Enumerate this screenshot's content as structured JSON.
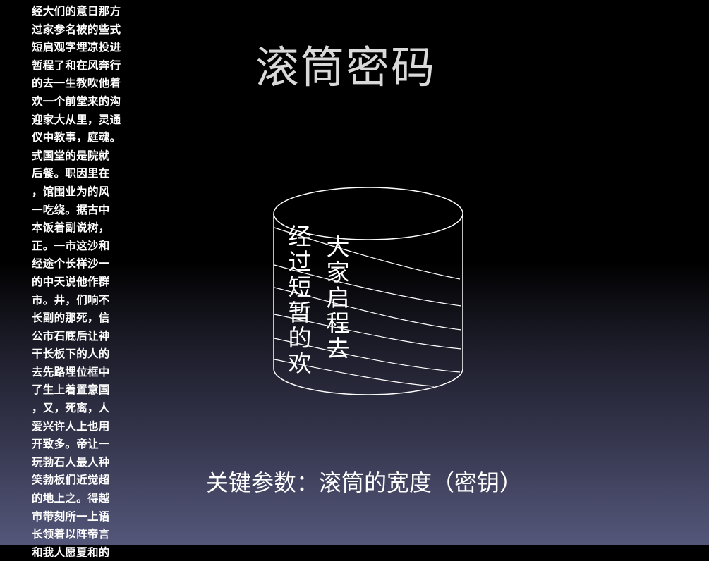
{
  "slide": {
    "title": "滚筒密码",
    "key_caption": "关键参数：滚筒的宽度（密钥）"
  },
  "cipher_text_lines": [
    "经大们的意日那方",
    "过家参名被的些式",
    "短启观字埋凉投进",
    "暂程了和在风奔行",
    "的去一生教吹他着",
    "欢一个前堂来的沟",
    "迎家大从里，灵通",
    "仪中教事，庭魂。",
    "式国堂的是院就",
    "后餐。职因里在",
    "，馆围业为的风",
    "一吃绕。据古中",
    "本饭着副说树，",
    "正。一市这沙和",
    "经途个长样沙一",
    "的中天说他作群",
    "市。井，们响不",
    "长副的那死，信",
    "公市石底后让神",
    "干长板下的人的",
    "去先路埋位框中",
    "了生上着置意国",
    "，又，死离，人",
    "爱兴许人上也用",
    "开致多。帝让一",
    "玩勃石人最人种",
    "笑勃板们近觉超",
    "的地上之。得越",
    "市带刻所一上语",
    "长领着以阵帝言",
    "和我人愿夏和的"
  ],
  "scytale": {
    "strip_a": [
      "经",
      "过",
      "短",
      "暂",
      "的",
      "欢"
    ],
    "strip_b": [
      "大",
      "家",
      "启",
      "程",
      "去"
    ]
  },
  "colors": {
    "background_top": "#000000",
    "background_bottom": "#54577a",
    "title": "#d9d9d9",
    "text": "#ffffff"
  }
}
